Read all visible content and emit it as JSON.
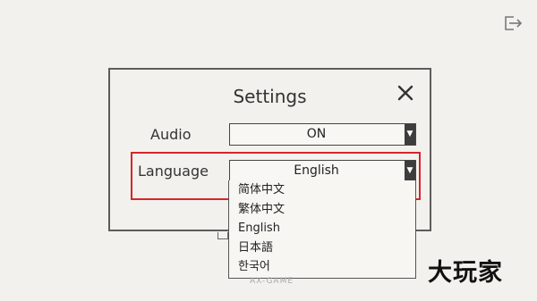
{
  "icons": {
    "top_right": "exit-icon",
    "close": "close-icon",
    "dropdown_arrow": "triangle-down-icon"
  },
  "settings": {
    "title": "Settings",
    "audio": {
      "label": "Audio",
      "value": "ON"
    },
    "language": {
      "label": "Language",
      "value": "English",
      "options": [
        "简体中文",
        "繁体中文",
        "English",
        "日本語",
        "한국어"
      ]
    }
  },
  "watermark": {
    "brand": "大玩家",
    "sub": "AX-GAME"
  },
  "colors": {
    "background": "#f3f1ed",
    "highlight": "#d6242c",
    "border": "#5c5c5c"
  }
}
